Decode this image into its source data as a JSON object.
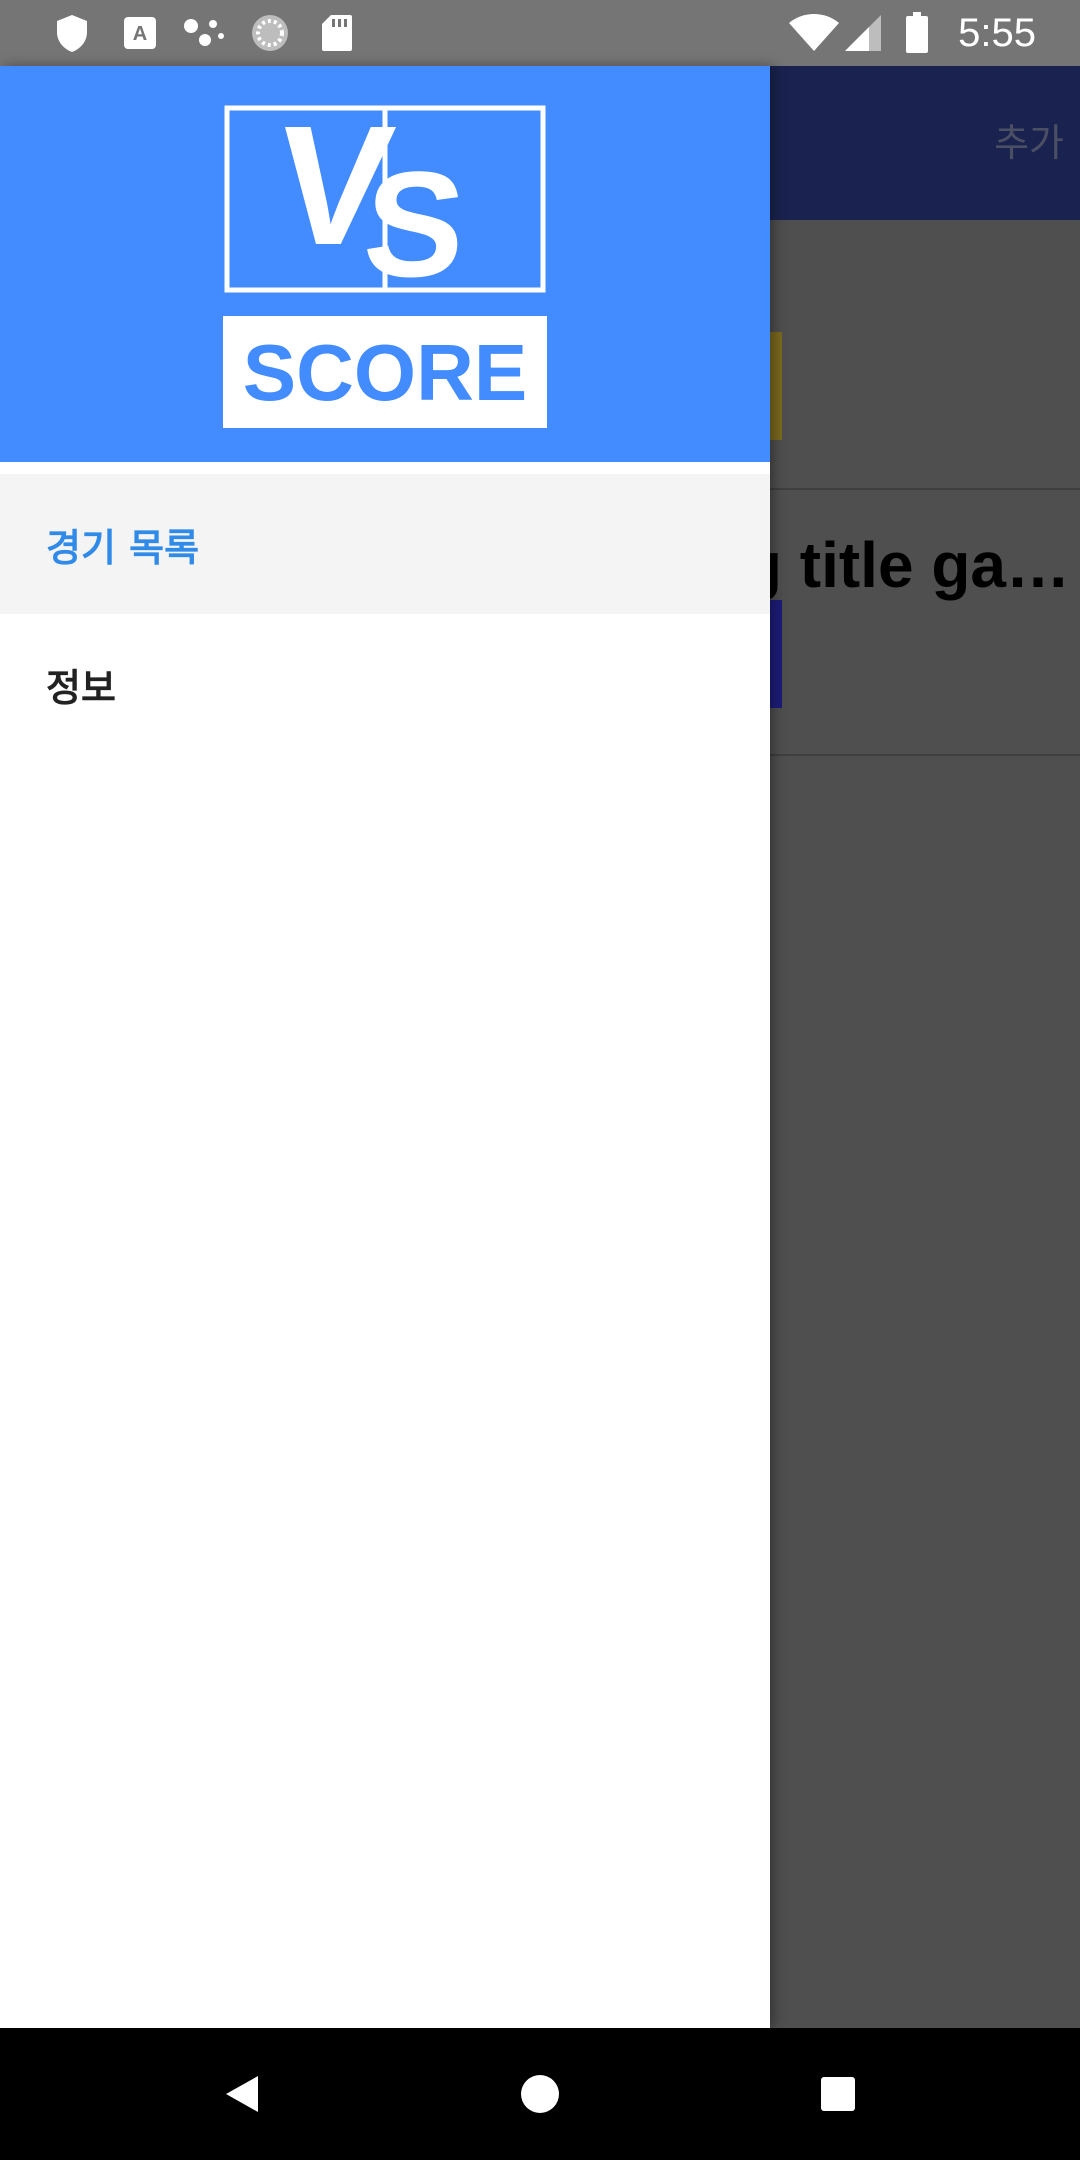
{
  "status_bar": {
    "time": "5:55",
    "icons_left": [
      "shield-icon",
      "font-download-icon",
      "dots-icon",
      "sync-icon",
      "sd-card-icon"
    ],
    "icons_right": [
      "wifi-icon",
      "signal-icon",
      "battery-icon"
    ]
  },
  "toolbar": {
    "action_label": "추가"
  },
  "game_list": [
    {
      "title": "",
      "bar_color": "#7a6a1e"
    },
    {
      "title": "g title ga…",
      "bar_color": "#1d1d7a"
    }
  ],
  "drawer": {
    "logo": {
      "top_text": "VS",
      "bottom_text": "SCORE",
      "background": "#428cff"
    },
    "items": [
      {
        "label": "경기 목록",
        "active": true
      },
      {
        "label": "정보",
        "active": false
      }
    ]
  },
  "nav_bar": {
    "buttons": [
      "back-icon",
      "home-icon",
      "recents-icon"
    ]
  },
  "colors": {
    "accent": "#428cff",
    "active_item_text": "#2f8ae8",
    "toolbar": "#1a2350"
  }
}
